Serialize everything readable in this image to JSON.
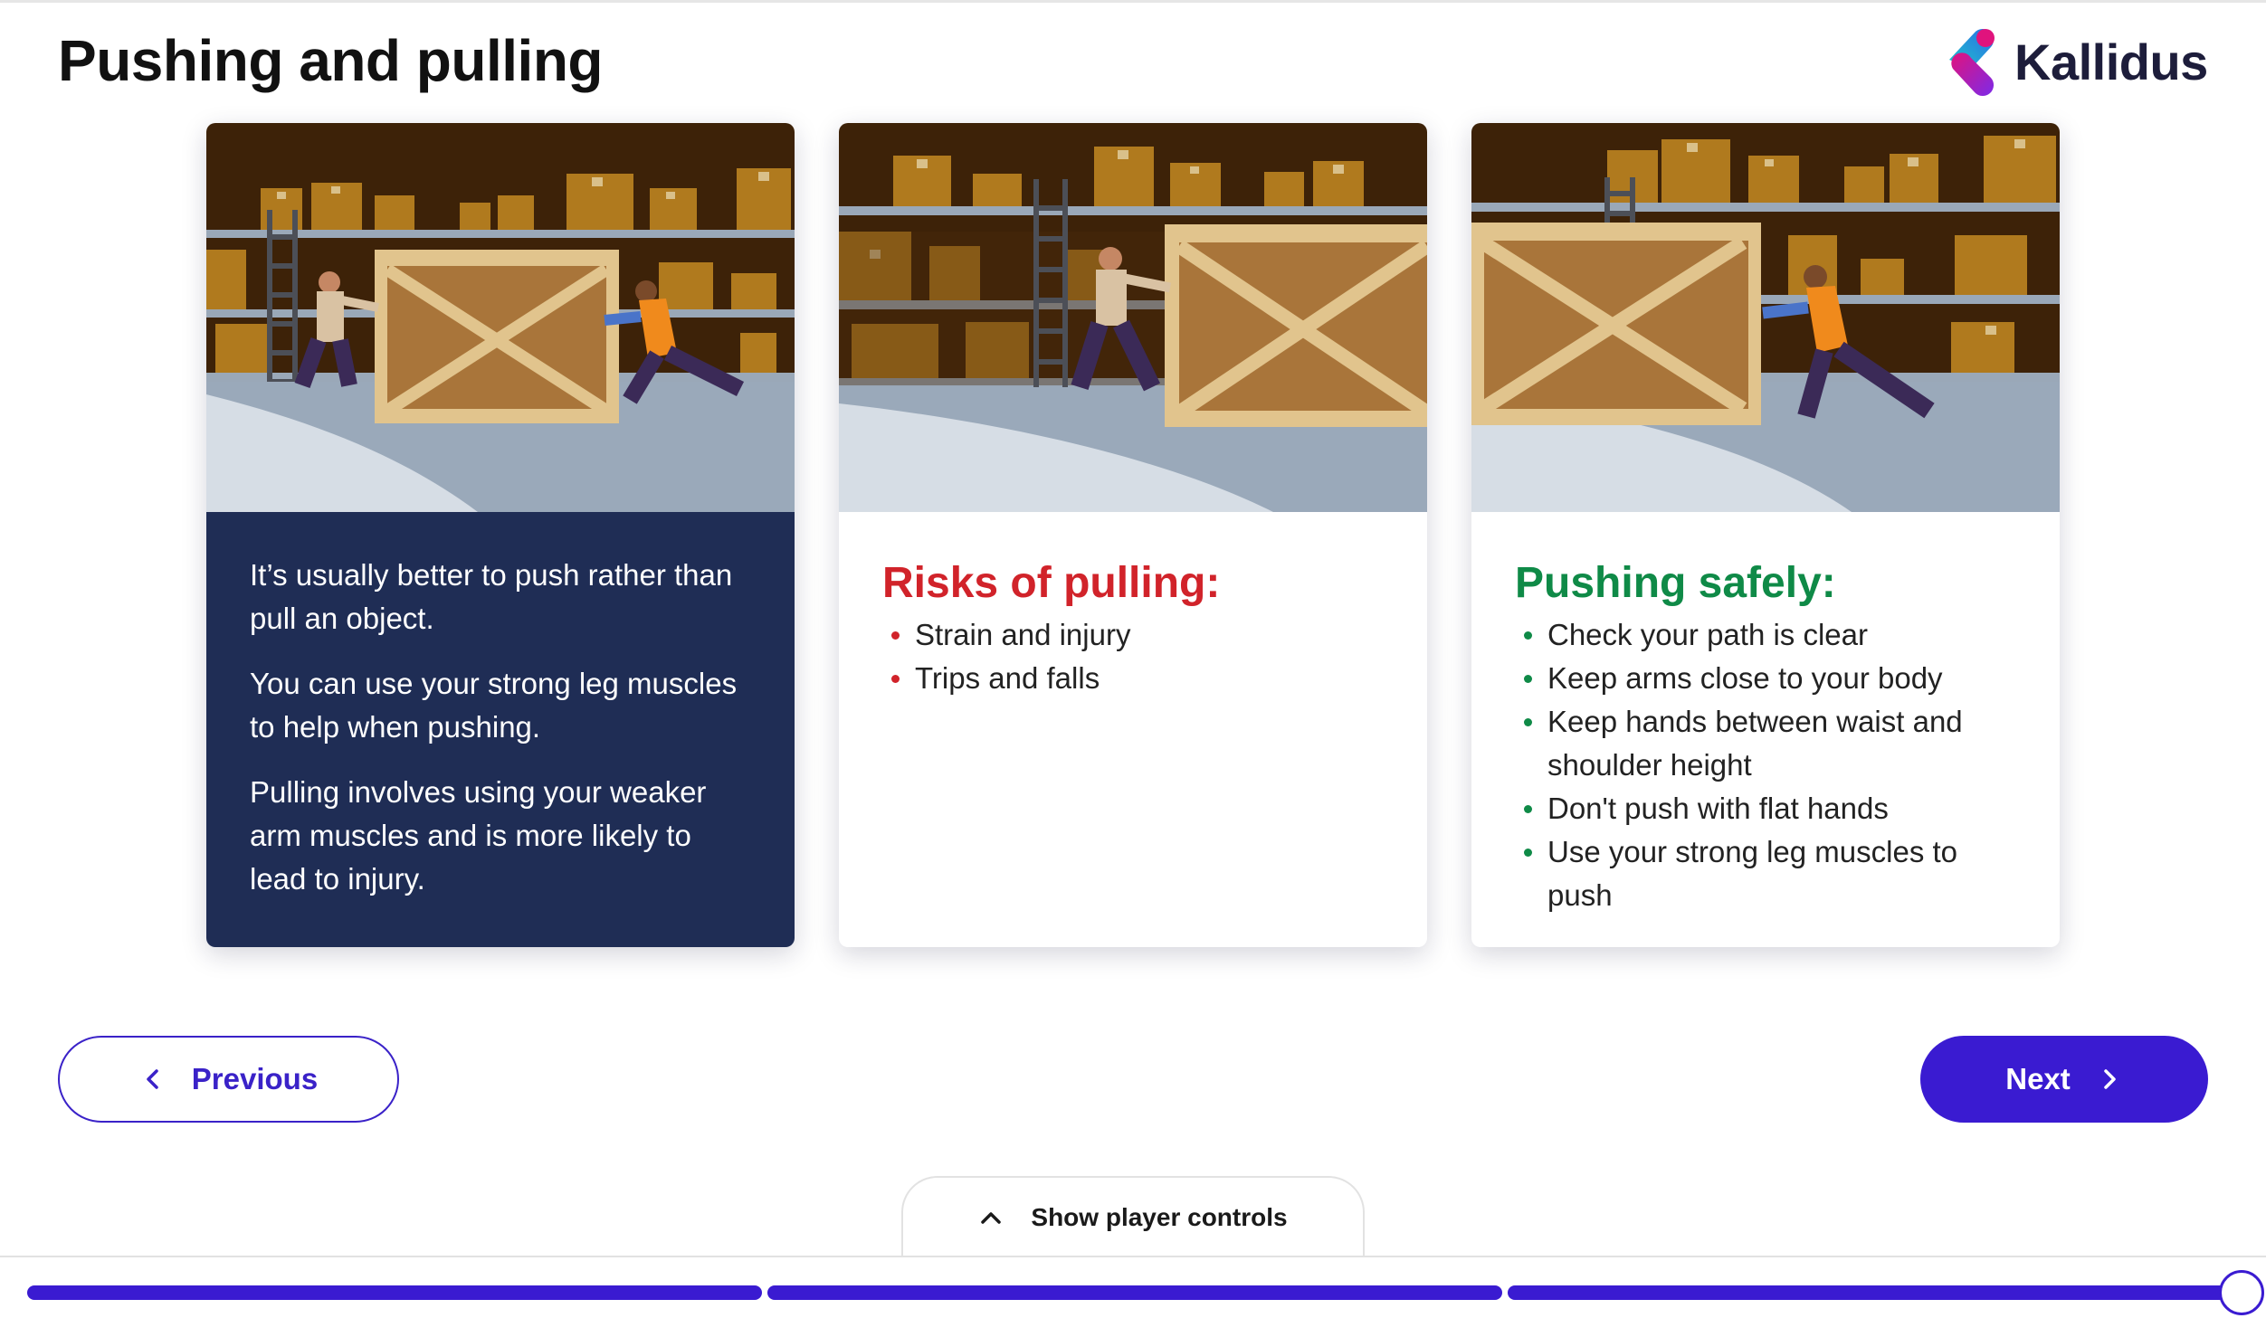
{
  "page": {
    "title": "Pushing and pulling"
  },
  "brand": {
    "name": "Kallidus",
    "colors": {
      "primary": "#3a1bd1",
      "navy_card": "#1f2d55",
      "risk_red": "#d1232a",
      "safe_green": "#0f8a47"
    }
  },
  "cards": [
    {
      "image": "warehouse-two-workers-pushing-crate",
      "paragraphs": [
        "It’s usually better to push rather than pull an object.",
        "You can use your strong leg muscles to help when pushing.",
        "Pulling involves using your weaker arm muscles and is more likely to lead to injury."
      ]
    },
    {
      "image": "warehouse-worker-pulling-crate",
      "heading": "Risks of pulling:",
      "bullets": [
        "Strain and injury",
        "Trips and falls"
      ]
    },
    {
      "image": "warehouse-worker-pushing-crate",
      "heading": "Pushing safely:",
      "bullets": [
        "Check your path is clear",
        "Keep arms close to your body",
        "Keep hands between waist and shoulder height",
        "Don't push with flat hands",
        "Use your strong leg muscles to push"
      ]
    }
  ],
  "nav": {
    "previous_label": "Previous",
    "next_label": "Next",
    "previous_icon": "chevron-left-icon",
    "next_icon": "chevron-right-icon"
  },
  "player": {
    "toggle_label": "Show player controls",
    "toggle_icon": "chevron-up-icon",
    "progress_segments": 3,
    "progress_fraction": 1.0
  }
}
